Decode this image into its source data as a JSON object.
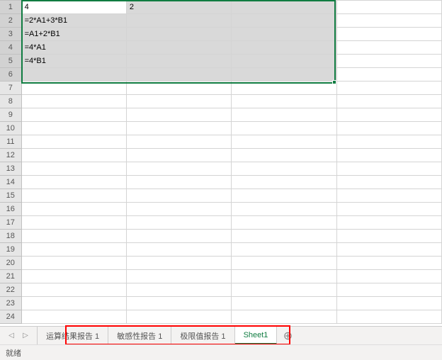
{
  "cells": {
    "A1": "4",
    "B1": "2",
    "A2": "=2*A1+3*B1",
    "A3": "=A1+2*B1",
    "A4": "=4*A1",
    "A5": "=4*B1"
  },
  "rows": 24,
  "selection": {
    "rows_selected": [
      1,
      2,
      3,
      4,
      5,
      6
    ],
    "active_cell": "A1"
  },
  "tabs": {
    "items": [
      {
        "label": "运算结果报告 1",
        "active": false
      },
      {
        "label": "敏感性报告 1",
        "active": false
      },
      {
        "label": "极限值报告 1",
        "active": false
      },
      {
        "label": "Sheet1",
        "active": true
      }
    ],
    "nav_prev": "◁",
    "nav_next": "▷",
    "add_icon": "⊕"
  },
  "status": {
    "ready": "就绪"
  }
}
